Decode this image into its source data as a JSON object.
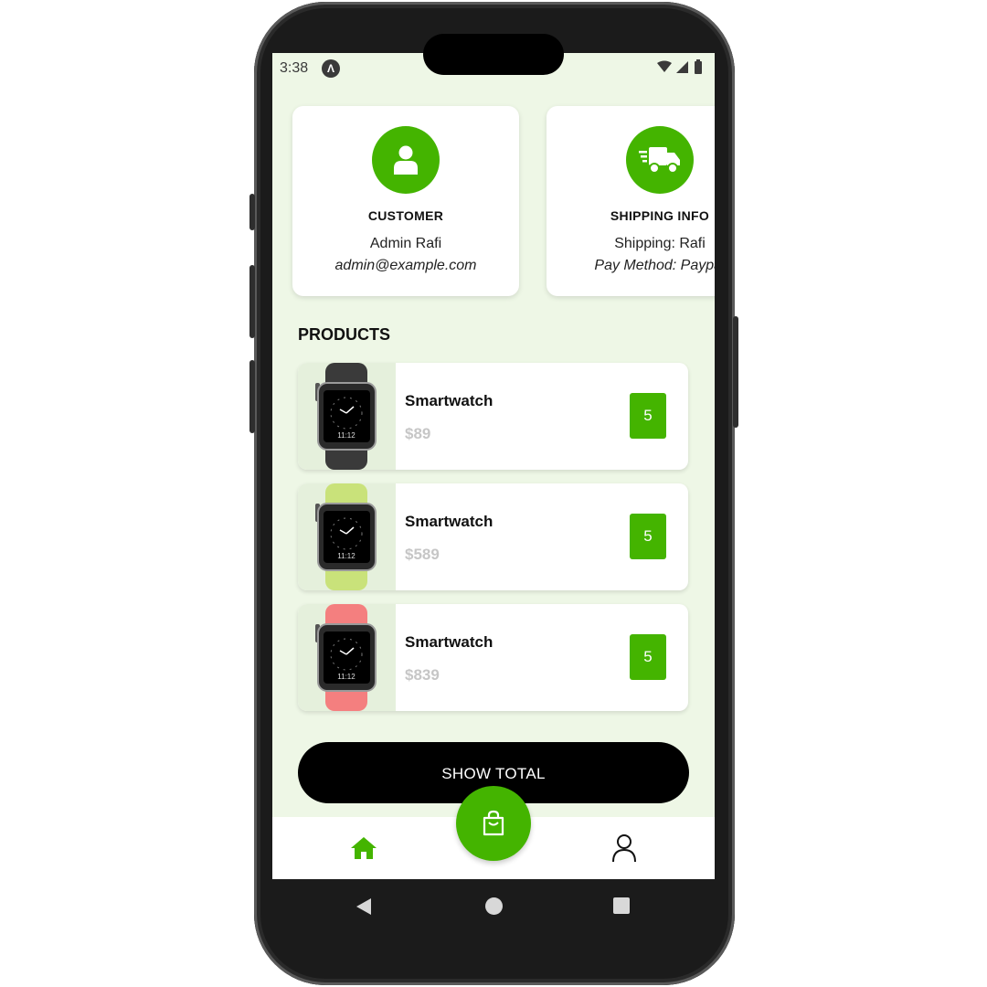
{
  "status_bar": {
    "time": "3:38",
    "app_icon_letter": "Λ"
  },
  "cards": [
    {
      "title": "CUSTOMER",
      "line1": "Admin Rafi",
      "line2": "admin@example.com",
      "icon": "user-icon"
    },
    {
      "title": "SHIPPING INFO",
      "line1": "Shipping: Rafi",
      "line2": "Pay Method: Paypal",
      "icon": "truck-icon"
    }
  ],
  "products_title": "PRODUCTS",
  "products": [
    {
      "name": "Smartwatch",
      "price": "$89",
      "qty": "5",
      "band_color": "#3a3a3a",
      "watch_time": "11:12"
    },
    {
      "name": "Smartwatch",
      "price": "$589",
      "qty": "5",
      "band_color": "#c9e27a",
      "watch_time": "11:12"
    },
    {
      "name": "Smartwatch",
      "price": "$839",
      "qty": "5",
      "band_color": "#f47f7f",
      "watch_time": "11:12"
    }
  ],
  "show_total_label": "SHOW TOTAL",
  "bottom_nav": {
    "home_icon": "home-icon",
    "cart_icon": "shopping-bag-icon",
    "profile_icon": "person-icon"
  },
  "colors": {
    "accent": "#44b400",
    "screen_bg": "#eef7e6",
    "price_gray": "#c6c6c6"
  }
}
